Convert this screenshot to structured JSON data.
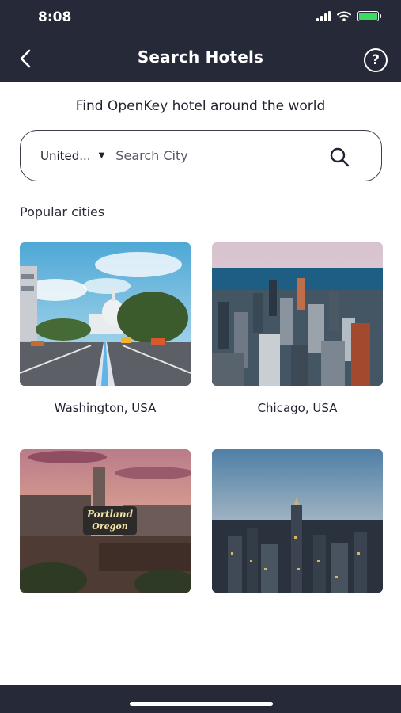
{
  "status_bar": {
    "time": "8:08"
  },
  "header": {
    "title": "Search Hotels",
    "help_label": "?"
  },
  "subtitle": "Find OpenKey hotel around the world",
  "search": {
    "country": "United...",
    "placeholder": "Search City"
  },
  "popular": {
    "label": "Popular cities",
    "cities": [
      {
        "name": "Washington, USA"
      },
      {
        "name": "Chicago, USA"
      },
      {
        "name": ""
      },
      {
        "name": ""
      }
    ]
  },
  "sign_text": "Portland Oregon",
  "colors": {
    "header_bg": "#262938",
    "battery": "#3ddc5f",
    "text": "#1f2230"
  }
}
